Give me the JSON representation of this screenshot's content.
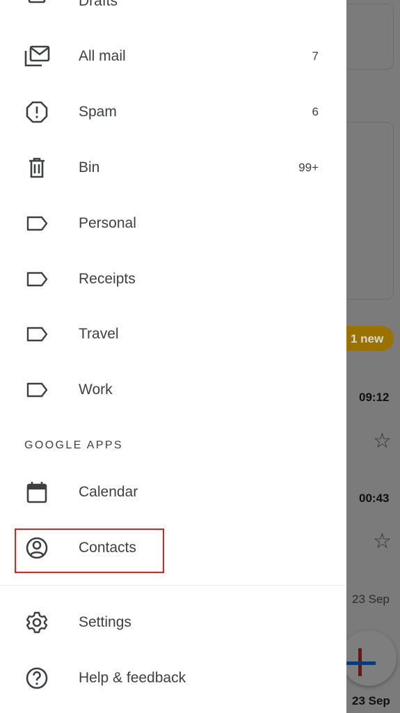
{
  "drawer": {
    "items": [
      {
        "label": "Drafts",
        "icon": "drafts-icon",
        "count": ""
      },
      {
        "label": "All mail",
        "icon": "all-mail-icon",
        "count": "7"
      },
      {
        "label": "Spam",
        "icon": "spam-icon",
        "count": "6"
      },
      {
        "label": "Bin",
        "icon": "bin-icon",
        "count": "99+"
      },
      {
        "label": "Personal",
        "icon": "label-icon",
        "count": ""
      },
      {
        "label": "Receipts",
        "icon": "label-icon",
        "count": ""
      },
      {
        "label": "Travel",
        "icon": "label-icon",
        "count": ""
      },
      {
        "label": "Work",
        "icon": "label-icon",
        "count": ""
      }
    ],
    "section_title": "GOOGLE APPS",
    "apps": [
      {
        "label": "Calendar",
        "icon": "calendar-icon"
      },
      {
        "label": "Contacts",
        "icon": "contacts-icon"
      }
    ],
    "footer": [
      {
        "label": "Settings",
        "icon": "gear-icon"
      },
      {
        "label": "Help & feedback",
        "icon": "help-icon"
      }
    ]
  },
  "background": {
    "new_badge": "1 new",
    "times": [
      "09:12",
      "00:43",
      "23 Sep",
      "23 Sep"
    ],
    "badge_color": "#f2a600"
  },
  "colors": {
    "highlight": "#e0201b",
    "text": "#3c4043"
  }
}
